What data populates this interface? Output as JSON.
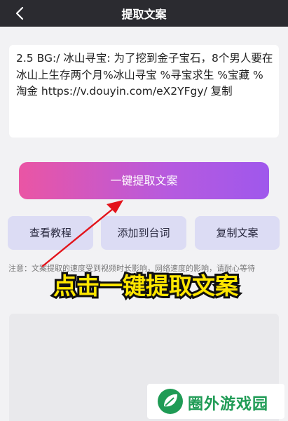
{
  "header": {
    "title": "提取文案",
    "back_icon": "chevron-left-icon"
  },
  "input_text": {
    "value": "2.5 BG:/ 冰山寻宝: 为了挖到金子宝石，8个男人要在冰山上生存两个月%冰山寻宝 %寻宝求生 %宝藏 %淘金 https://v.douyin.com/eX2YFgy/ 复制"
  },
  "actions": {
    "extract_label": "一键提取文案",
    "tutorial_label": "查看教程",
    "add_line_label": "添加到台词",
    "copy_label": "复制文案"
  },
  "notice": {
    "text": "注意：文案提取的速度受到视频时长影响，网络速度的影响，请耐心等待"
  },
  "caption": {
    "text": "点击一键提取文案"
  },
  "watermark": {
    "text": "圈外游戏园",
    "icon": "leaf-logo-icon"
  },
  "colors": {
    "header_bg": "#2b2b30",
    "button_gradient_start": "#ea55a4",
    "button_gradient_end": "#9f58ec",
    "secondary_button_bg": "#dcdcf4",
    "caption_fill": "#ffe600",
    "arrow": "#e3141b",
    "watermark_green": "#1f9b55"
  }
}
